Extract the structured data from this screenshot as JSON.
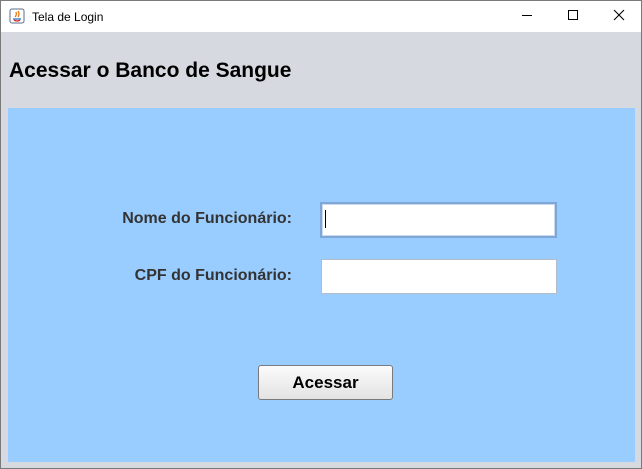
{
  "window": {
    "title": "Tela de Login",
    "icon": "java-icon",
    "controls": {
      "minimize_icon": "minimize-icon",
      "maximize_icon": "maximize-icon",
      "close_icon": "close-icon"
    }
  },
  "main": {
    "heading": "Acessar o Banco de Sangue",
    "form": {
      "name_label": "Nome do Funcionário:",
      "name_value": "",
      "cpf_label": "CPF do Funcionário:",
      "cpf_value": "",
      "submit_label": "Acessar"
    }
  },
  "colors": {
    "panel_background": "#99ccff",
    "window_background": "#d6d9df",
    "label_text": "#333333"
  }
}
